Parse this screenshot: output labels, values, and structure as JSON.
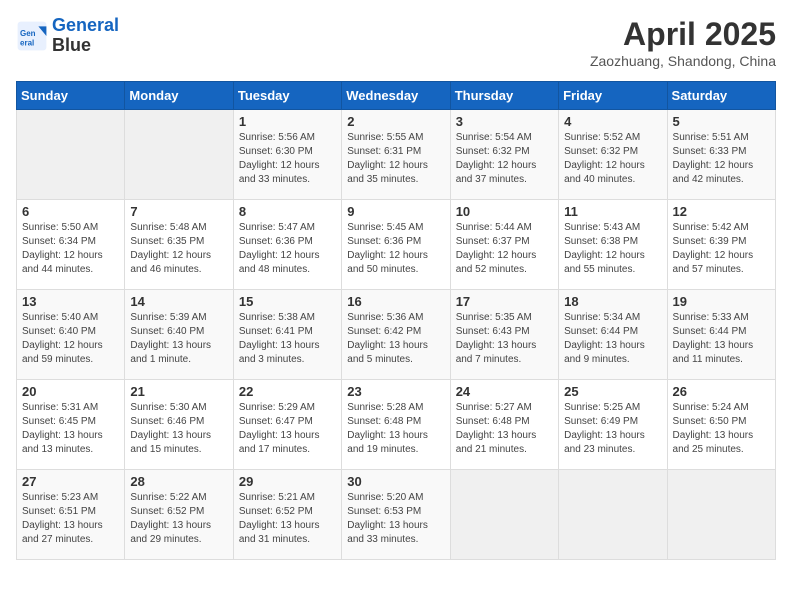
{
  "header": {
    "logo_line1": "General",
    "logo_line2": "Blue",
    "month": "April 2025",
    "location": "Zaozhuang, Shandong, China"
  },
  "weekdays": [
    "Sunday",
    "Monday",
    "Tuesday",
    "Wednesday",
    "Thursday",
    "Friday",
    "Saturday"
  ],
  "weeks": [
    [
      {
        "day": null
      },
      {
        "day": null
      },
      {
        "day": "1",
        "sunrise": "Sunrise: 5:56 AM",
        "sunset": "Sunset: 6:30 PM",
        "daylight": "Daylight: 12 hours and 33 minutes."
      },
      {
        "day": "2",
        "sunrise": "Sunrise: 5:55 AM",
        "sunset": "Sunset: 6:31 PM",
        "daylight": "Daylight: 12 hours and 35 minutes."
      },
      {
        "day": "3",
        "sunrise": "Sunrise: 5:54 AM",
        "sunset": "Sunset: 6:32 PM",
        "daylight": "Daylight: 12 hours and 37 minutes."
      },
      {
        "day": "4",
        "sunrise": "Sunrise: 5:52 AM",
        "sunset": "Sunset: 6:32 PM",
        "daylight": "Daylight: 12 hours and 40 minutes."
      },
      {
        "day": "5",
        "sunrise": "Sunrise: 5:51 AM",
        "sunset": "Sunset: 6:33 PM",
        "daylight": "Daylight: 12 hours and 42 minutes."
      }
    ],
    [
      {
        "day": "6",
        "sunrise": "Sunrise: 5:50 AM",
        "sunset": "Sunset: 6:34 PM",
        "daylight": "Daylight: 12 hours and 44 minutes."
      },
      {
        "day": "7",
        "sunrise": "Sunrise: 5:48 AM",
        "sunset": "Sunset: 6:35 PM",
        "daylight": "Daylight: 12 hours and 46 minutes."
      },
      {
        "day": "8",
        "sunrise": "Sunrise: 5:47 AM",
        "sunset": "Sunset: 6:36 PM",
        "daylight": "Daylight: 12 hours and 48 minutes."
      },
      {
        "day": "9",
        "sunrise": "Sunrise: 5:45 AM",
        "sunset": "Sunset: 6:36 PM",
        "daylight": "Daylight: 12 hours and 50 minutes."
      },
      {
        "day": "10",
        "sunrise": "Sunrise: 5:44 AM",
        "sunset": "Sunset: 6:37 PM",
        "daylight": "Daylight: 12 hours and 52 minutes."
      },
      {
        "day": "11",
        "sunrise": "Sunrise: 5:43 AM",
        "sunset": "Sunset: 6:38 PM",
        "daylight": "Daylight: 12 hours and 55 minutes."
      },
      {
        "day": "12",
        "sunrise": "Sunrise: 5:42 AM",
        "sunset": "Sunset: 6:39 PM",
        "daylight": "Daylight: 12 hours and 57 minutes."
      }
    ],
    [
      {
        "day": "13",
        "sunrise": "Sunrise: 5:40 AM",
        "sunset": "Sunset: 6:40 PM",
        "daylight": "Daylight: 12 hours and 59 minutes."
      },
      {
        "day": "14",
        "sunrise": "Sunrise: 5:39 AM",
        "sunset": "Sunset: 6:40 PM",
        "daylight": "Daylight: 13 hours and 1 minute."
      },
      {
        "day": "15",
        "sunrise": "Sunrise: 5:38 AM",
        "sunset": "Sunset: 6:41 PM",
        "daylight": "Daylight: 13 hours and 3 minutes."
      },
      {
        "day": "16",
        "sunrise": "Sunrise: 5:36 AM",
        "sunset": "Sunset: 6:42 PM",
        "daylight": "Daylight: 13 hours and 5 minutes."
      },
      {
        "day": "17",
        "sunrise": "Sunrise: 5:35 AM",
        "sunset": "Sunset: 6:43 PM",
        "daylight": "Daylight: 13 hours and 7 minutes."
      },
      {
        "day": "18",
        "sunrise": "Sunrise: 5:34 AM",
        "sunset": "Sunset: 6:44 PM",
        "daylight": "Daylight: 13 hours and 9 minutes."
      },
      {
        "day": "19",
        "sunrise": "Sunrise: 5:33 AM",
        "sunset": "Sunset: 6:44 PM",
        "daylight": "Daylight: 13 hours and 11 minutes."
      }
    ],
    [
      {
        "day": "20",
        "sunrise": "Sunrise: 5:31 AM",
        "sunset": "Sunset: 6:45 PM",
        "daylight": "Daylight: 13 hours and 13 minutes."
      },
      {
        "day": "21",
        "sunrise": "Sunrise: 5:30 AM",
        "sunset": "Sunset: 6:46 PM",
        "daylight": "Daylight: 13 hours and 15 minutes."
      },
      {
        "day": "22",
        "sunrise": "Sunrise: 5:29 AM",
        "sunset": "Sunset: 6:47 PM",
        "daylight": "Daylight: 13 hours and 17 minutes."
      },
      {
        "day": "23",
        "sunrise": "Sunrise: 5:28 AM",
        "sunset": "Sunset: 6:48 PM",
        "daylight": "Daylight: 13 hours and 19 minutes."
      },
      {
        "day": "24",
        "sunrise": "Sunrise: 5:27 AM",
        "sunset": "Sunset: 6:48 PM",
        "daylight": "Daylight: 13 hours and 21 minutes."
      },
      {
        "day": "25",
        "sunrise": "Sunrise: 5:25 AM",
        "sunset": "Sunset: 6:49 PM",
        "daylight": "Daylight: 13 hours and 23 minutes."
      },
      {
        "day": "26",
        "sunrise": "Sunrise: 5:24 AM",
        "sunset": "Sunset: 6:50 PM",
        "daylight": "Daylight: 13 hours and 25 minutes."
      }
    ],
    [
      {
        "day": "27",
        "sunrise": "Sunrise: 5:23 AM",
        "sunset": "Sunset: 6:51 PM",
        "daylight": "Daylight: 13 hours and 27 minutes."
      },
      {
        "day": "28",
        "sunrise": "Sunrise: 5:22 AM",
        "sunset": "Sunset: 6:52 PM",
        "daylight": "Daylight: 13 hours and 29 minutes."
      },
      {
        "day": "29",
        "sunrise": "Sunrise: 5:21 AM",
        "sunset": "Sunset: 6:52 PM",
        "daylight": "Daylight: 13 hours and 31 minutes."
      },
      {
        "day": "30",
        "sunrise": "Sunrise: 5:20 AM",
        "sunset": "Sunset: 6:53 PM",
        "daylight": "Daylight: 13 hours and 33 minutes."
      },
      {
        "day": null
      },
      {
        "day": null
      },
      {
        "day": null
      }
    ]
  ]
}
